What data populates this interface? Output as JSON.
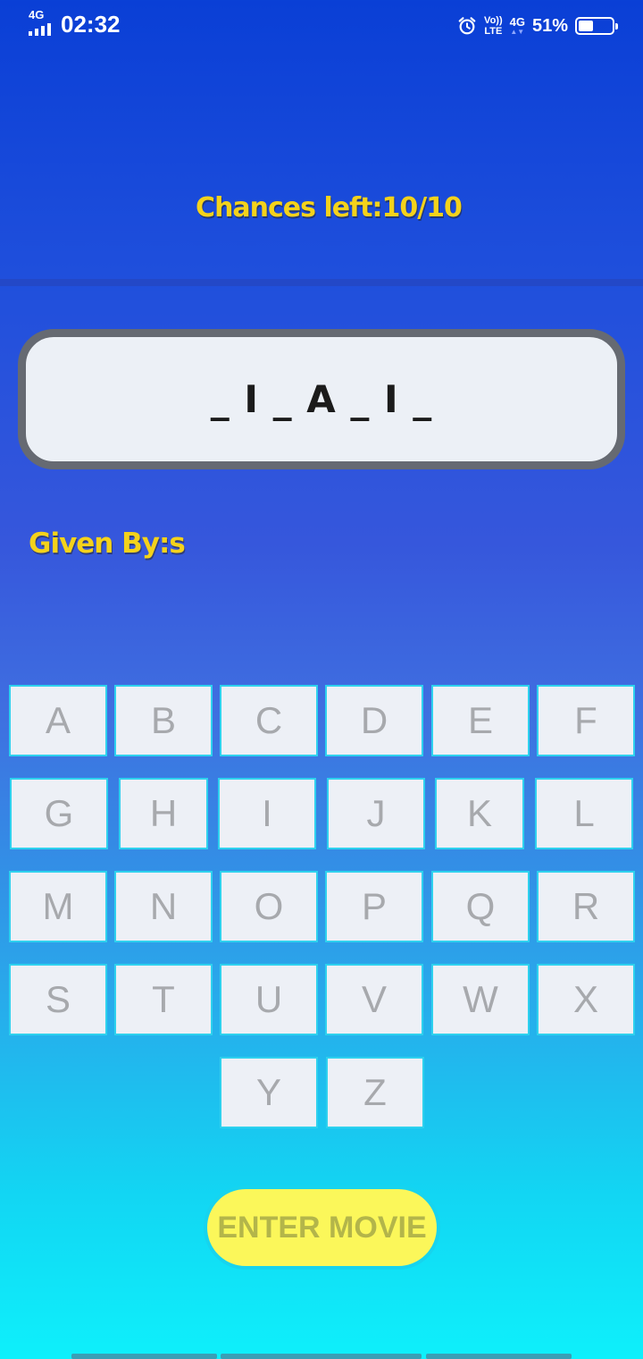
{
  "status_bar": {
    "network_tag": "4G",
    "time": "02:32",
    "volte_top": "Vo))",
    "volte_bottom": "LTE",
    "network_type": "4G",
    "battery_percent": "51%",
    "battery_level": 0.51
  },
  "game": {
    "chances_label": "Chances left:10/10",
    "word_pattern": "_ I _ A _ I _",
    "given_by_label": "Given By:s"
  },
  "keyboard": {
    "keys": [
      "A",
      "B",
      "C",
      "D",
      "E",
      "F",
      "G",
      "H",
      "I",
      "J",
      "K",
      "L",
      "M",
      "N",
      "O",
      "P",
      "Q",
      "R",
      "S",
      "T",
      "U",
      "V",
      "W",
      "X",
      "Y",
      "Z"
    ]
  },
  "enter_button": {
    "label": "ENTER MOVIE"
  },
  "colors": {
    "accent_yellow": "#f4d21b",
    "key_border": "#2ed1ee",
    "button_fill": "#fbf75a"
  }
}
